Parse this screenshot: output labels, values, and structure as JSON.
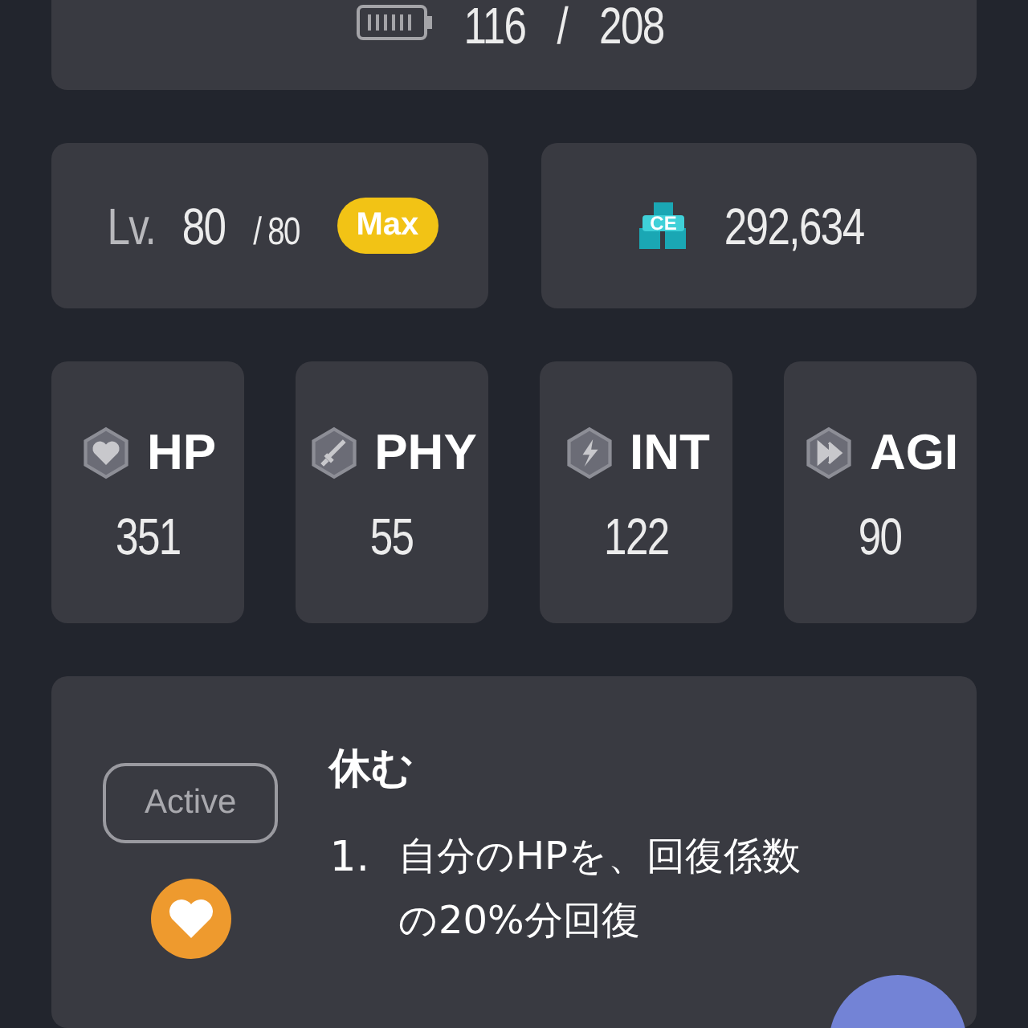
{
  "stamina": {
    "current": "116",
    "separator": "/",
    "max": "208"
  },
  "level": {
    "prefix": "Lv.",
    "current": "80",
    "max": "/ 80",
    "badge": "Max"
  },
  "currency": {
    "code": "CE",
    "amount": "292,634"
  },
  "stats": [
    {
      "kind": "heart",
      "label": "HP",
      "value": "351"
    },
    {
      "kind": "sword",
      "label": "PHY",
      "value": "55"
    },
    {
      "kind": "bolt",
      "label": "INT",
      "value": "122"
    },
    {
      "kind": "speed",
      "label": "AGI",
      "value": "90"
    }
  ],
  "skill": {
    "badge": "Active",
    "name": "休む",
    "effects": [
      {
        "number": "1.",
        "text": "自分のHPを、回復係数の20%分回復"
      }
    ]
  }
}
